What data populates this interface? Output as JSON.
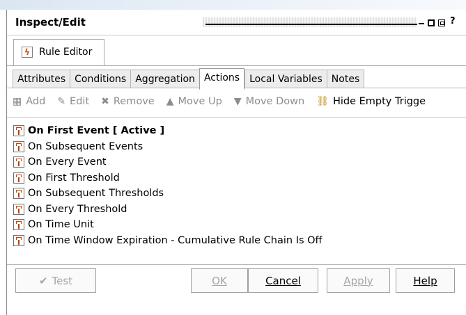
{
  "window": {
    "title": "Inspect/Edit",
    "controls": {
      "help": "?"
    }
  },
  "editor_tab": {
    "label": "Rule Editor",
    "icon": "rule-icon"
  },
  "tabs": [
    {
      "label": "Attributes",
      "active": false
    },
    {
      "label": "Conditions",
      "active": false
    },
    {
      "label": "Aggregation",
      "active": false
    },
    {
      "label": "Actions",
      "active": true
    },
    {
      "label": "Local Variables",
      "active": false
    },
    {
      "label": "Notes",
      "active": false
    }
  ],
  "toolbar": {
    "add": "Add",
    "edit": "Edit",
    "remove": "Remove",
    "move_up": "Move Up",
    "move_down": "Move Down",
    "hide_empty": "Hide Empty Trigge"
  },
  "tree_items": [
    "On First Event [ Active ]",
    "On Subsequent Events",
    "On Every Event",
    "On First Threshold",
    "On Subsequent Thresholds",
    "On Every Threshold",
    "On Time Unit",
    "On Time Window Expiration - Cumulative Rule Chain Is Off"
  ],
  "buttons": {
    "test": "Test",
    "ok": "OK",
    "cancel": "Cancel",
    "apply": "Apply",
    "help": "Help"
  },
  "colors": {
    "icon_accent": "#c04000",
    "disabled_text": "#8d8d8d"
  }
}
